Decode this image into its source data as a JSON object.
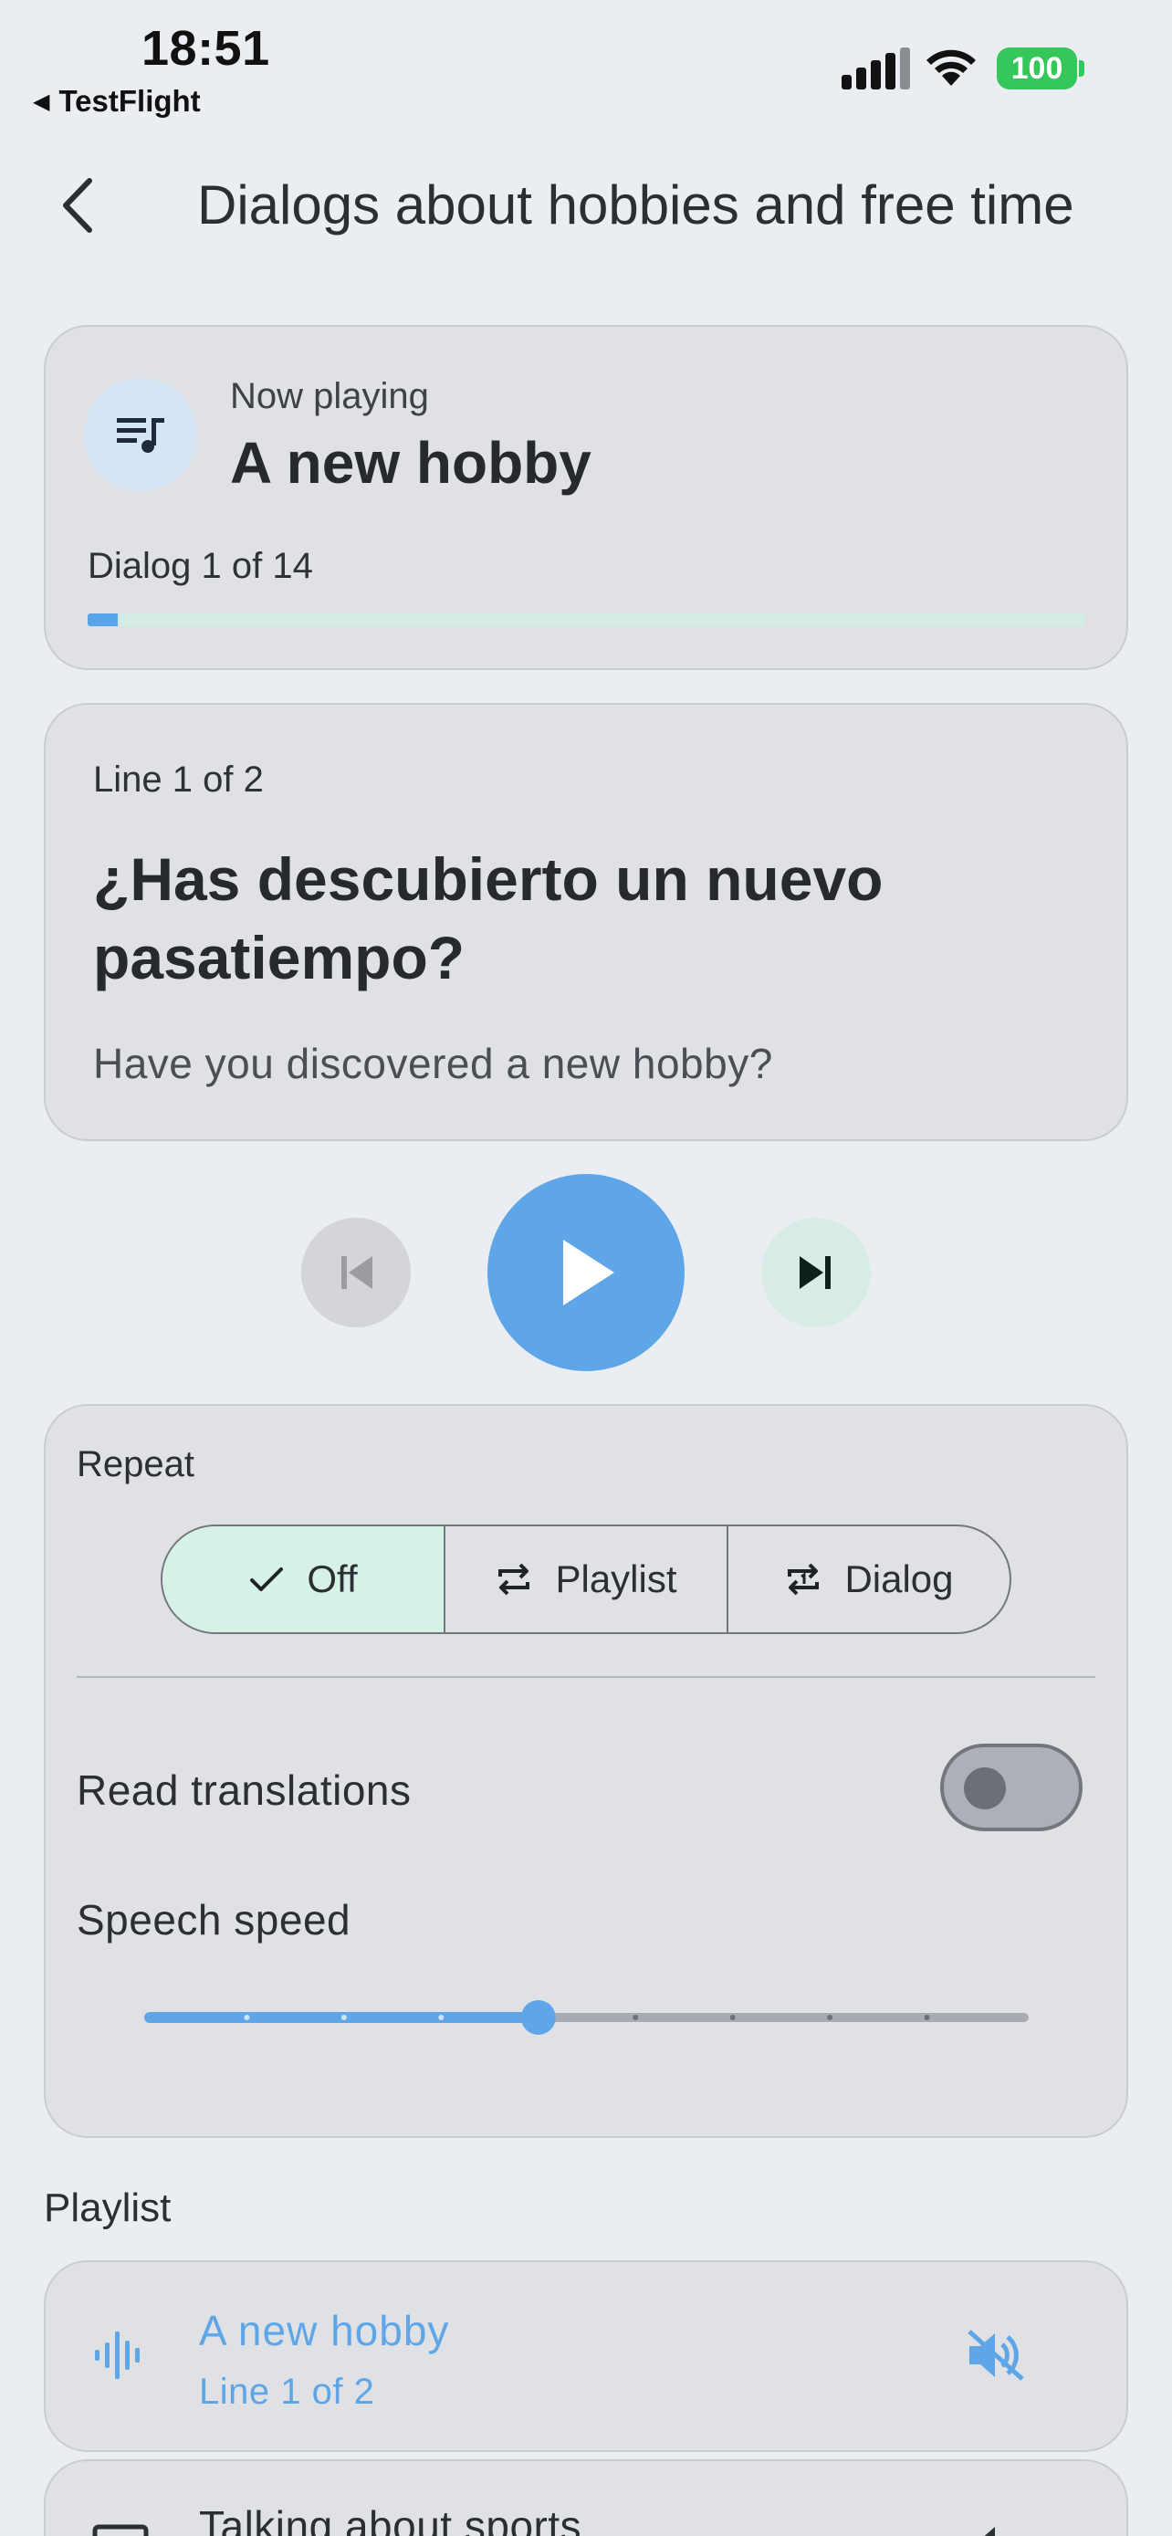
{
  "status_bar": {
    "time": "18:51",
    "back_app": "TestFlight",
    "battery": "100",
    "icons": [
      "cellular-signal-icon",
      "wifi-icon",
      "battery-icon"
    ]
  },
  "header": {
    "title": "Dialogs about hobbies and free time",
    "back_icon": "chevron-left-icon"
  },
  "now_playing": {
    "label": "Now playing",
    "title": "A new hobby",
    "dialog_count": "Dialog 1 of 14",
    "progress_fraction": 0.03,
    "icon": "playlist-music-icon"
  },
  "current_line": {
    "count": "Line 1 of 2",
    "text": "¿Has descubierto un nuevo pasatiempo?",
    "translation": "Have you discovered a new hobby?"
  },
  "controls": {
    "previous_icon": "skip-previous-icon",
    "play_icon": "play-icon",
    "next_icon": "skip-next-icon",
    "previous_enabled": false
  },
  "settings": {
    "repeat_label": "Repeat",
    "repeat_options": [
      {
        "label": "Off",
        "icon": "check-icon",
        "selected": true
      },
      {
        "label": "Playlist",
        "icon": "repeat-icon",
        "selected": false
      },
      {
        "label": "Dialog",
        "icon": "repeat-one-icon",
        "selected": false
      }
    ],
    "read_translations_label": "Read translations",
    "read_translations_on": false,
    "speech_speed_label": "Speech speed",
    "speech_speed_steps": 10,
    "speech_speed_value_index": 4
  },
  "playlist": {
    "heading": "Playlist",
    "items": [
      {
        "title": "A new hobby",
        "subtitle": "Line 1 of 2",
        "active": true,
        "leading_icon": "audio-wave-icon",
        "trailing_icon": "volume-off-icon"
      },
      {
        "title": "Talking about sports",
        "active": false,
        "leading_icon": "message-icon",
        "trailing_icon": "volume-icon"
      }
    ]
  },
  "colors": {
    "background": "#eaedf1",
    "card": "#dfe1e5",
    "accent_blue": "#5ea6e8",
    "accent_mint": "#d6f1e6",
    "battery_green": "#35c759"
  }
}
